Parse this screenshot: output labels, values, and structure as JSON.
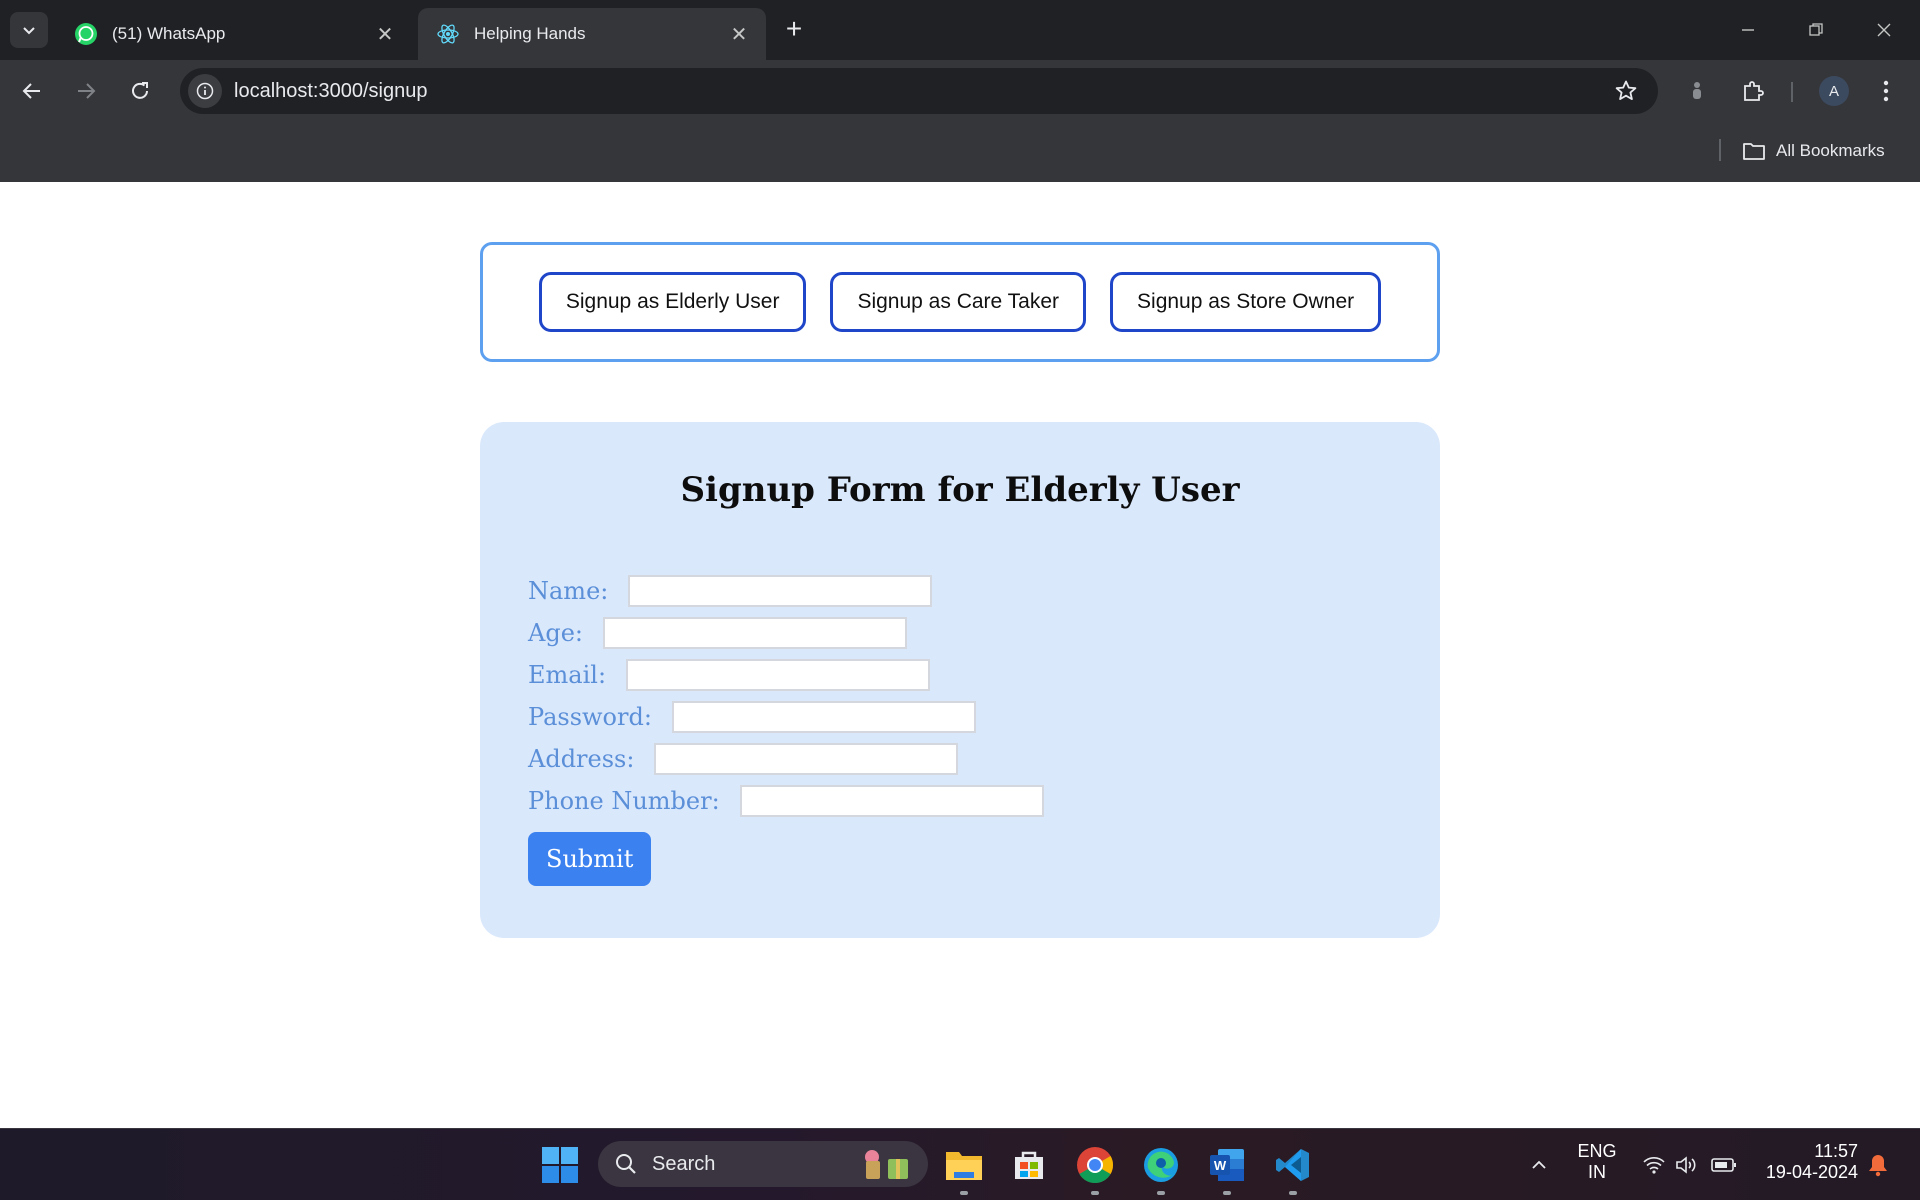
{
  "browser": {
    "tabs": [
      {
        "title": "(51) WhatsApp",
        "icon": "whatsapp-icon",
        "active": false
      },
      {
        "title": "Helping Hands",
        "icon": "react-icon",
        "active": true
      }
    ],
    "url": "localhost:3000/signup",
    "profile_initial": "A",
    "bookmarks_label": "All Bookmarks"
  },
  "page": {
    "role_buttons": [
      {
        "label": "Signup as Elderly User"
      },
      {
        "label": "Signup as Care Taker"
      },
      {
        "label": "Signup as Store Owner"
      }
    ],
    "form": {
      "title": "Signup Form for Elderly User",
      "fields": [
        {
          "label": "Name:",
          "value": ""
        },
        {
          "label": "Age:",
          "value": ""
        },
        {
          "label": "Email:",
          "value": ""
        },
        {
          "label": "Password:",
          "value": ""
        },
        {
          "label": "Address:",
          "value": ""
        },
        {
          "label": "Phone Number:",
          "value": ""
        }
      ],
      "submit_label": "Submit"
    },
    "colors": {
      "accent": "#3b82f0",
      "card_bg": "#dae8fc",
      "label": "#5b8fd8",
      "role_border": "#1f45c9"
    }
  },
  "taskbar": {
    "search_placeholder": "Search",
    "apps": [
      "windows-start-icon",
      "file-explorer-icon",
      "microsoft-store-icon",
      "chrome-icon",
      "edge-icon",
      "word-icon",
      "vscode-icon"
    ],
    "language": "ENG",
    "region": "IN",
    "time": "11:57",
    "date": "19-04-2024"
  }
}
